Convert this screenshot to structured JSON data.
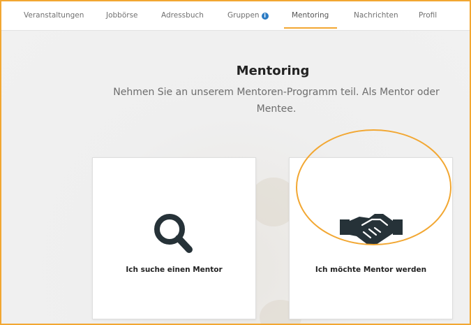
{
  "nav": {
    "items": [
      {
        "label": "Veranstaltungen"
      },
      {
        "label": "Jobbörse"
      },
      {
        "label": "Adressbuch"
      },
      {
        "label": "Gruppen",
        "badge_icon": "info-circle-icon"
      },
      {
        "label": "Mentoring",
        "active": true
      },
      {
        "label": "Nachrichten"
      },
      {
        "label": "Profil"
      }
    ]
  },
  "main": {
    "title": "Mentoring",
    "subtitle": "Nehmen Sie an unserem Mentoren-Programm teil. Als Mentor oder Mentee."
  },
  "cards": [
    {
      "label": "Ich suche einen Mentor",
      "icon": "search-icon"
    },
    {
      "label": "Ich möchte Mentor werden",
      "icon": "handshake-icon"
    }
  ],
  "colors": {
    "accent": "#f2a732",
    "info_badge": "#2b7bc4",
    "icon_dark": "#263238"
  }
}
